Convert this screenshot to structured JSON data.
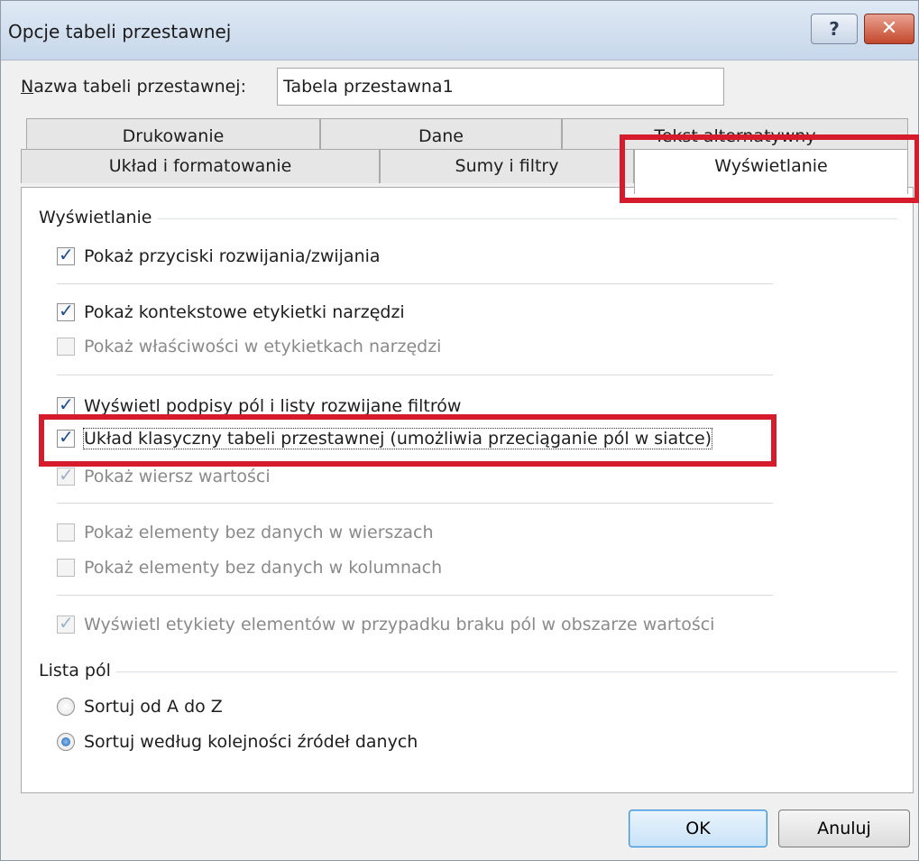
{
  "dialog": {
    "title": "Opcje tabeli przestawnej",
    "help_symbol": "?",
    "close_symbol": "✕"
  },
  "name_field": {
    "label_underlined": "N",
    "label_rest": "azwa tabeli przestawnej:",
    "value": "Tabela przestawna1"
  },
  "tabs": {
    "row1": [
      "Drukowanie",
      "Dane",
      "Tekst alternatywny"
    ],
    "row2": [
      "Układ i formatowanie",
      "Sumy i filtry",
      "Wyświetlanie"
    ],
    "active": "Wyświetlanie"
  },
  "display_group": {
    "title": "Wyświetlanie",
    "options": [
      {
        "label": "Pokaż przyciski rozwijania/zwijania",
        "checked": true,
        "enabled": true
      },
      {
        "label": "Pokaż kontekstowe etykietki narzędzi",
        "checked": true,
        "enabled": true
      },
      {
        "label": "Pokaż właściwości w etykietkach narzędzi",
        "checked": false,
        "enabled": false
      },
      {
        "label": "Wyświetl podpisy pól i listy rozwijane filtrów",
        "checked": true,
        "enabled": true
      },
      {
        "label": "Układ klasyczny tabeli przestawnej (umożliwia przeciąganie pól w siatce)",
        "checked": true,
        "enabled": true,
        "focused": true
      },
      {
        "label": "Pokaż wiersz wartości",
        "checked": true,
        "enabled": false
      },
      {
        "label": "Pokaż elementy bez danych w wierszach",
        "checked": false,
        "enabled": false
      },
      {
        "label": "Pokaż elementy bez danych w kolumnach",
        "checked": false,
        "enabled": false
      },
      {
        "label": "Wyświetl etykiety elementów w przypadku braku pól w obszarze wartości",
        "checked": true,
        "enabled": false
      }
    ]
  },
  "field_list_group": {
    "title": "Lista pól",
    "options": [
      {
        "label": "Sortuj od A do Z",
        "selected": false
      },
      {
        "label": "Sortuj według kolejności źródeł danych",
        "selected": true
      }
    ]
  },
  "buttons": {
    "ok": "OK",
    "cancel": "Anuluj"
  },
  "colors": {
    "highlight": "#d61b2c",
    "title_bar": "#c7d7ea",
    "close_button": "#c3472c"
  }
}
